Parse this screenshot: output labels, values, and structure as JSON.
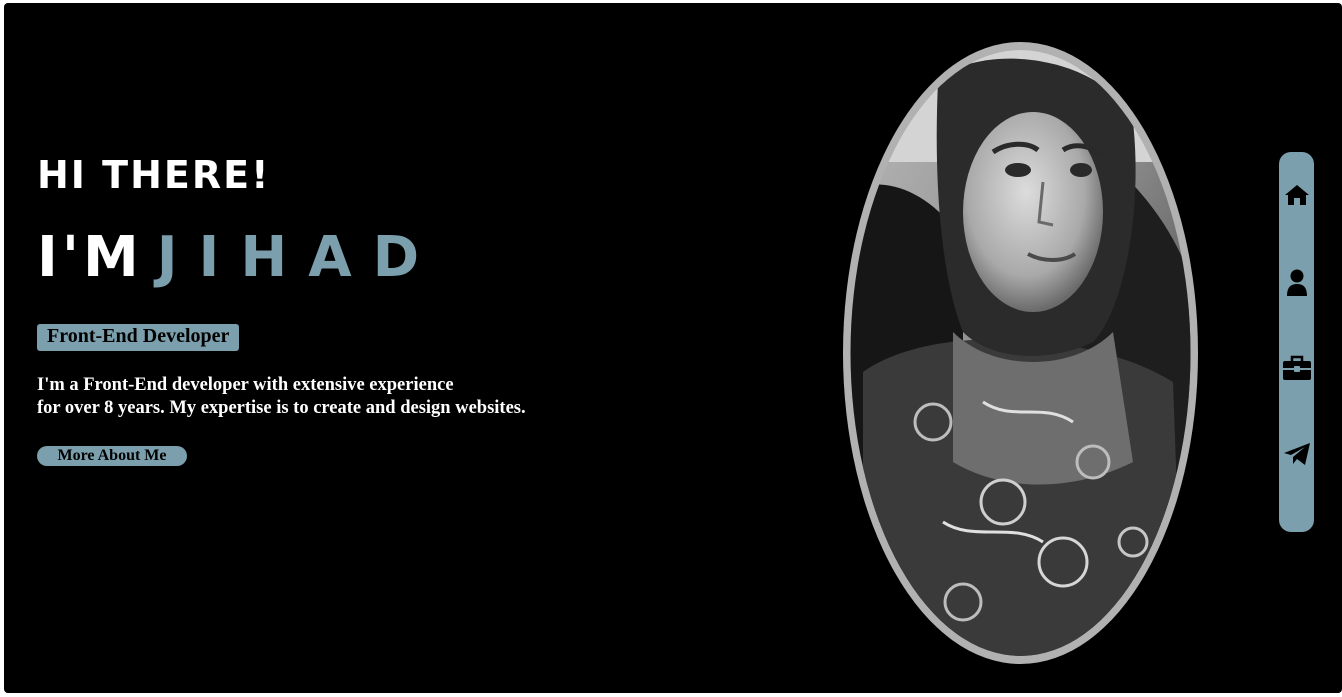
{
  "hero": {
    "greeting": "HI THERE!",
    "intro_prefix": "I'M",
    "name": "JIHAD",
    "role": "Front-End Developer",
    "bio_line_1": "I'm a Front-End developer with extensive experience",
    "bio_line_2": "for over 8 years. My expertise is to create and design websites.",
    "cta_label": "More About Me"
  },
  "nav": {
    "items": [
      {
        "icon": "home-icon"
      },
      {
        "icon": "user-icon"
      },
      {
        "icon": "briefcase-icon"
      },
      {
        "icon": "paper-plane-icon"
      }
    ]
  },
  "colors": {
    "background": "#000000",
    "accent": "#7b9fac",
    "text": "#ffffff",
    "portrait_frame": "#b1b1b1"
  }
}
